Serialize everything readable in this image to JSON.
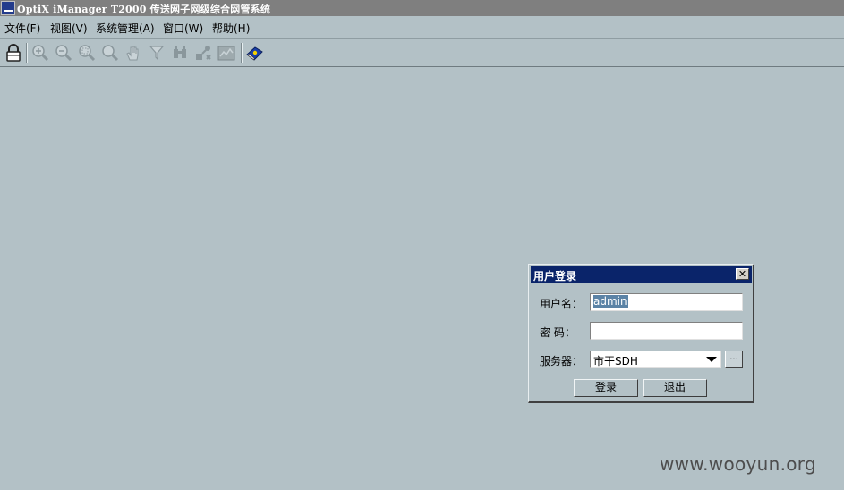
{
  "window": {
    "app_icon": "optix-app-icon",
    "title": "OptiX iManager T2000 传送网子网级综合网管系统"
  },
  "menu": [
    {
      "label": "文件(F)"
    },
    {
      "label": "视图(V)"
    },
    {
      "label": "系统管理(A)"
    },
    {
      "label": "窗口(W)"
    },
    {
      "label": "帮助(H)"
    }
  ],
  "toolbar": {
    "buttons": [
      {
        "icon": "lock-icon",
        "enabled": true
      },
      {
        "icon": "zoom-in-icon",
        "enabled": false
      },
      {
        "icon": "zoom-out-icon",
        "enabled": false
      },
      {
        "icon": "zoom-area-icon",
        "enabled": false
      },
      {
        "icon": "zoom-reset-icon",
        "enabled": false
      },
      {
        "icon": "hand-pan-icon",
        "enabled": false
      },
      {
        "icon": "filter-icon",
        "enabled": false
      },
      {
        "icon": "binoculars-search-icon",
        "enabled": false
      },
      {
        "icon": "topology-link-icon",
        "enabled": false
      },
      {
        "icon": "map-view-icon",
        "enabled": false
      },
      {
        "icon": "help-book-icon",
        "enabled": true
      }
    ]
  },
  "login_dialog": {
    "title": "用户登录",
    "close_glyph": "✕",
    "username_label": "用户名：",
    "username_value": "admin",
    "password_label": "密 码：",
    "password_value": "",
    "server_label": "服务器：",
    "server_selected": "市干SDH",
    "browse_label": "...",
    "login_button": "登录",
    "exit_button": "退出"
  },
  "watermark": "www.wooyun.org",
  "colors": {
    "desktop_bg": "#b3c1c6",
    "titlebar_bg": "#7f7f7f",
    "dialog_title_bg": "#0a246a",
    "selection_bg": "#5b83a6"
  }
}
